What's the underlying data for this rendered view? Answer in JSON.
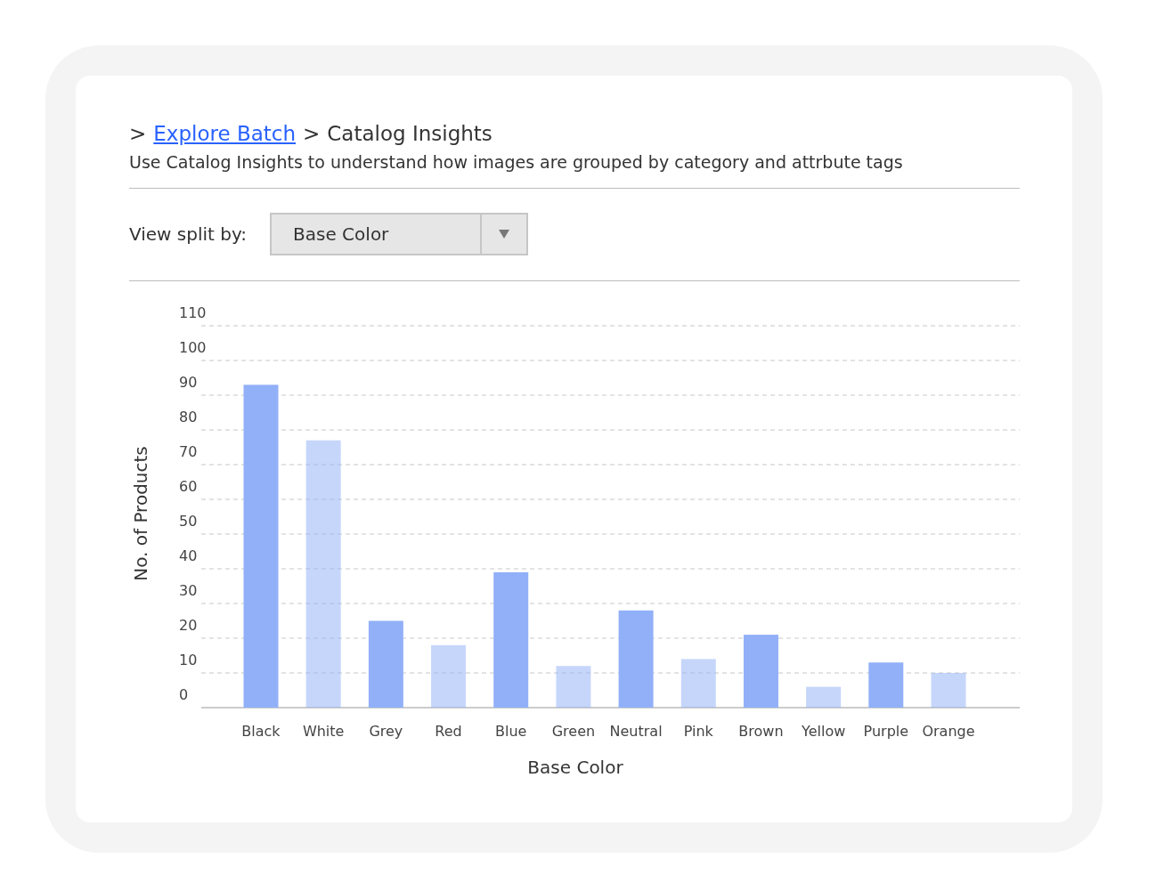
{
  "breadcrumb": {
    "separator": ">",
    "link": "Explore Batch",
    "current": "Catalog Insights"
  },
  "description": "Use Catalog Insights to understand how images are grouped by category and attrbute tags",
  "view_split": {
    "label": "View split by:",
    "value": "Base Color"
  },
  "chart_data": {
    "type": "bar",
    "xlabel": "Base Color",
    "ylabel": "No. of Products",
    "categories": [
      "Black",
      "White",
      "Grey",
      "Red",
      "Blue",
      "Green",
      "Neutral",
      "Pink",
      "Brown",
      "Yellow",
      "Purple",
      "Orange"
    ],
    "grid": true,
    "series": [
      {
        "color": "#91b0f8",
        "values": [
          93,
          77,
          25,
          18,
          39,
          12,
          28,
          14,
          21,
          6,
          13,
          10
        ]
      }
    ],
    "ylim": [
      0,
      110
    ],
    "yticks": [
      0,
      10,
      20,
      30,
      40,
      50,
      60,
      70,
      80,
      90,
      100,
      110
    ]
  }
}
